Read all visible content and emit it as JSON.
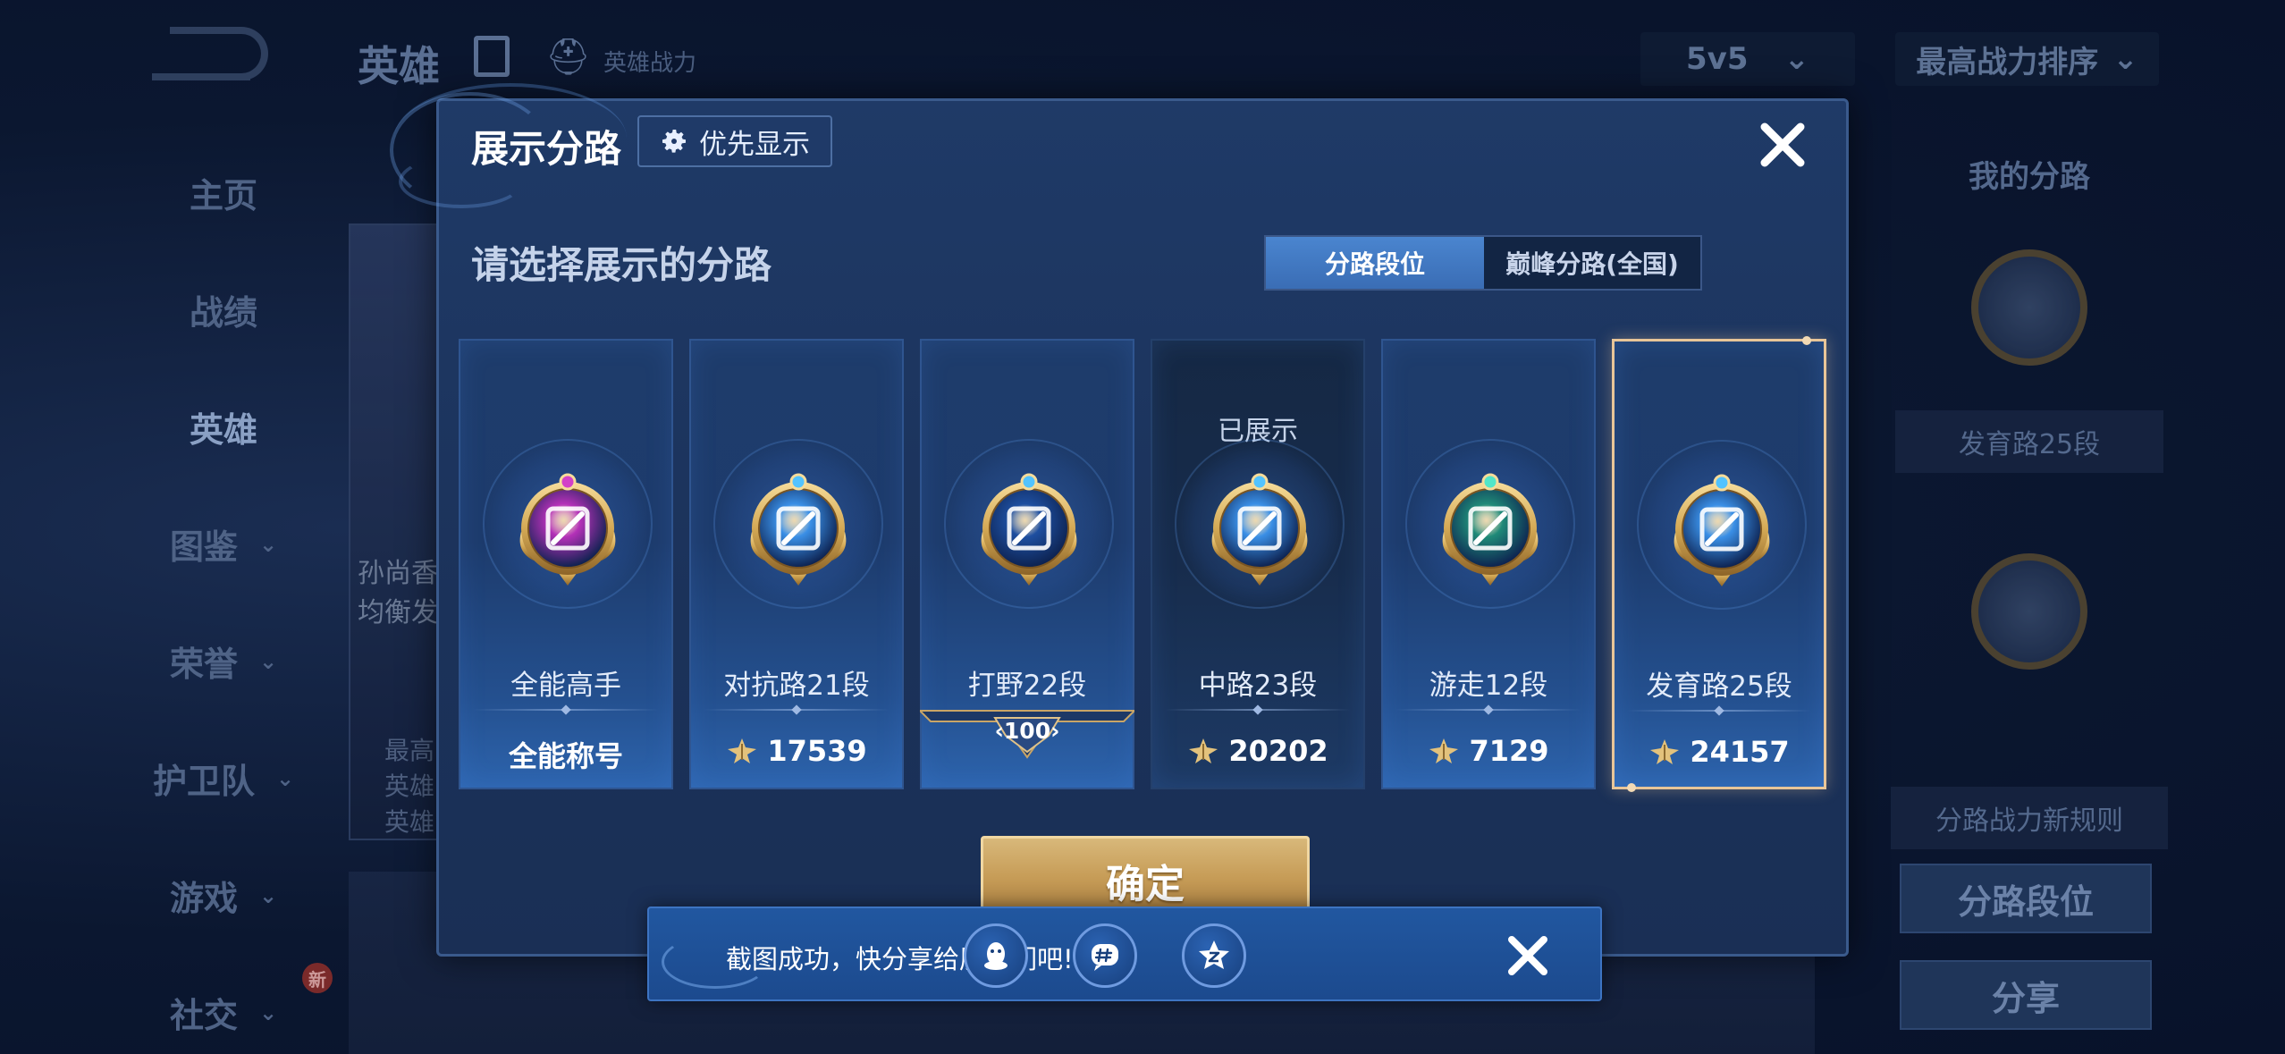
{
  "background": {
    "header_title": "英雄",
    "hero_power_label": "英雄战力",
    "mode_select": "5v5",
    "sort_select": "最高战力排序",
    "nav": [
      {
        "label": "主页",
        "chevron": false
      },
      {
        "label": "战绩",
        "chevron": false
      },
      {
        "label": "英雄",
        "chevron": false,
        "active": true
      },
      {
        "label": "图鉴",
        "chevron": true
      },
      {
        "label": "荣誉",
        "chevron": true
      },
      {
        "label": "护卫队",
        "chevron": true
      },
      {
        "label": "游戏",
        "chevron": true
      },
      {
        "label": "社交",
        "chevron": true,
        "badge": "新"
      }
    ],
    "hero_card_text_1": "孙尚香",
    "hero_card_text_2": "均衡发",
    "hero_card_text_3": "最高",
    "hero_card_text_4": "英雄",
    "hero_card_text_5": "英雄",
    "right_panel": {
      "title": "我的分路",
      "lane_label": "发育路25段",
      "rule_label": "分路战力新规则",
      "btn_lane_rank": "分路段位",
      "btn_share": "分享"
    }
  },
  "dialog": {
    "title": "展示分路",
    "priority_label": "优先显示",
    "subtitle": "请选择展示的分路",
    "tabs": [
      {
        "label": "分路段位",
        "active": true
      },
      {
        "label": "巅峰分路(全国)",
        "active": false
      }
    ],
    "lanes": [
      {
        "name": "全能高手",
        "value": "全能称号",
        "icon": "all-round-badge-icon",
        "gem": "#d340c8",
        "core": "#b431b8",
        "style": "normal",
        "show_power_icon": false
      },
      {
        "name": "对抗路21段",
        "value": "17539",
        "icon": "clash-lane-badge-icon",
        "gem": "#52c3ff",
        "core": "#3a8fe6",
        "style": "normal",
        "show_power_icon": true
      },
      {
        "name": "打野22段",
        "value": "",
        "level": "100",
        "icon": "jungle-dragon-badge-icon",
        "gem": "#52c3ff",
        "core": "#1e4fa0",
        "style": "normal",
        "show_power_icon": false
      },
      {
        "name": "中路23段",
        "value": "20202",
        "icon": "mid-lane-badge-icon",
        "gem": "#52c3ff",
        "core": "#3a8fe6",
        "style": "dim",
        "shown_label": "已展示",
        "show_power_icon": true
      },
      {
        "name": "游走12段",
        "value": "7129",
        "icon": "roam-badge-icon",
        "gem": "#52e6c8",
        "core": "#1f8a78",
        "style": "normal",
        "show_power_icon": true
      },
      {
        "name": "发育路25段",
        "value": "24157",
        "icon": "farm-lane-badge-icon",
        "gem": "#52c3ff",
        "core": "#3a8fe6",
        "style": "selected",
        "show_power_icon": true
      }
    ],
    "confirm_label": "确定"
  },
  "toast": {
    "text": "截图成功，快分享给朋友们吧!",
    "share_targets": [
      "qq-icon",
      "wechat-moments-icon",
      "qzone-icon"
    ]
  },
  "colors": {
    "accent_gold": "#c79d58",
    "selected_border": "#e8c598",
    "tab_active": "#4a85cf",
    "dialog_bg": "#1f3a67"
  }
}
